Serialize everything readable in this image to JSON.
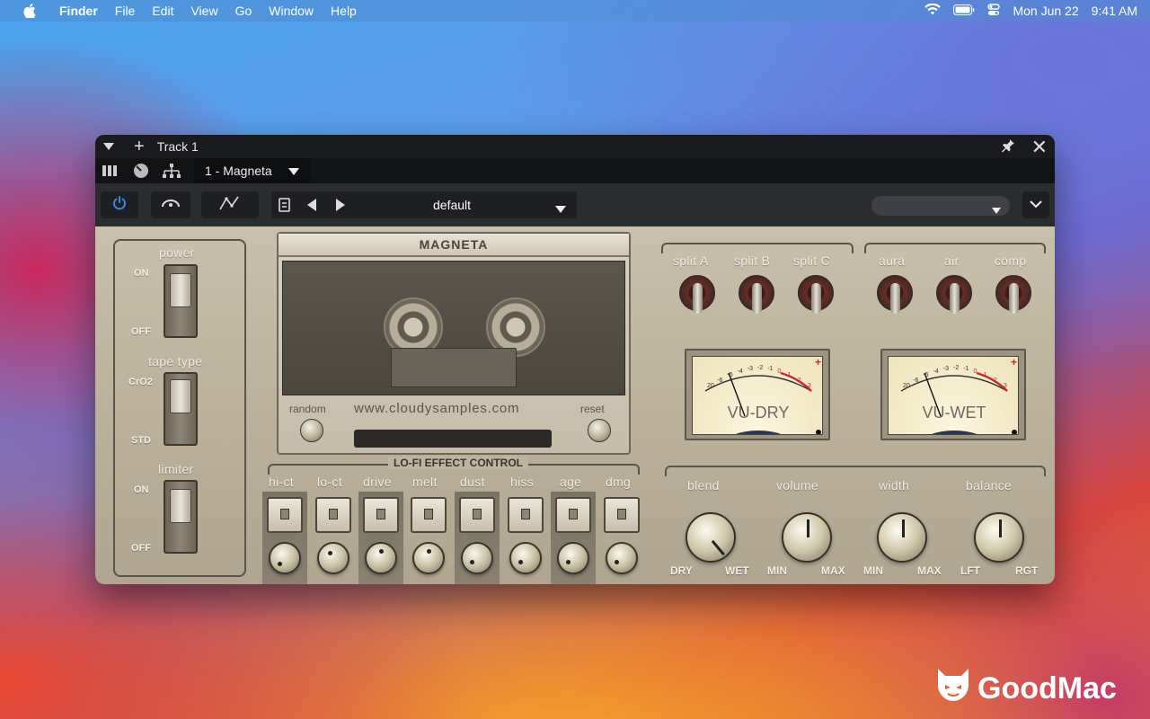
{
  "menubar": {
    "items": [
      "Finder",
      "File",
      "Edit",
      "View",
      "Go",
      "Window",
      "Help"
    ],
    "date": "Mon Jun 22",
    "time": "9:41 AM"
  },
  "window": {
    "title": "Track 1",
    "plugin_slot": "1 - Magneta",
    "preset": "default"
  },
  "plugin": {
    "brand": "MAGNETA",
    "website": "www.cloudysamples.com",
    "random_label": "random",
    "reset_label": "reset",
    "power": {
      "label": "power",
      "on": "ON",
      "off": "OFF"
    },
    "tape_type": {
      "label": "tape type",
      "top": "CrO2",
      "bottom": "STD"
    },
    "limiter": {
      "label": "limiter",
      "on": "ON",
      "off": "OFF"
    },
    "lofi_title": "LO-FI EFFECT CONTROL",
    "lofi": [
      "hi-ct",
      "lo-ct",
      "drive",
      "melt",
      "dust",
      "hiss",
      "age",
      "dmg"
    ],
    "splits": [
      "split A",
      "split B",
      "split C"
    ],
    "extras": [
      "aura",
      "air",
      "comp"
    ],
    "vu_dry": "VU-DRY",
    "vu_wet": "VU-WET",
    "vu_scale": [
      "20",
      "-6",
      "-5",
      "-4",
      "-3",
      "-2",
      "-1",
      "0",
      "1",
      "2",
      "3"
    ],
    "knobs": [
      {
        "label": "blend",
        "min": "DRY",
        "max": "WET"
      },
      {
        "label": "volume",
        "min": "MIN",
        "max": "MAX"
      },
      {
        "label": "width",
        "min": "MIN",
        "max": "MAX"
      },
      {
        "label": "balance",
        "min": "LFT",
        "max": "RGT"
      }
    ]
  },
  "watermark": "GoodMac",
  "colors": {
    "accent": "#2f8be6",
    "faceplate": "#c0b7a1",
    "vu_red": "#c8282a"
  }
}
